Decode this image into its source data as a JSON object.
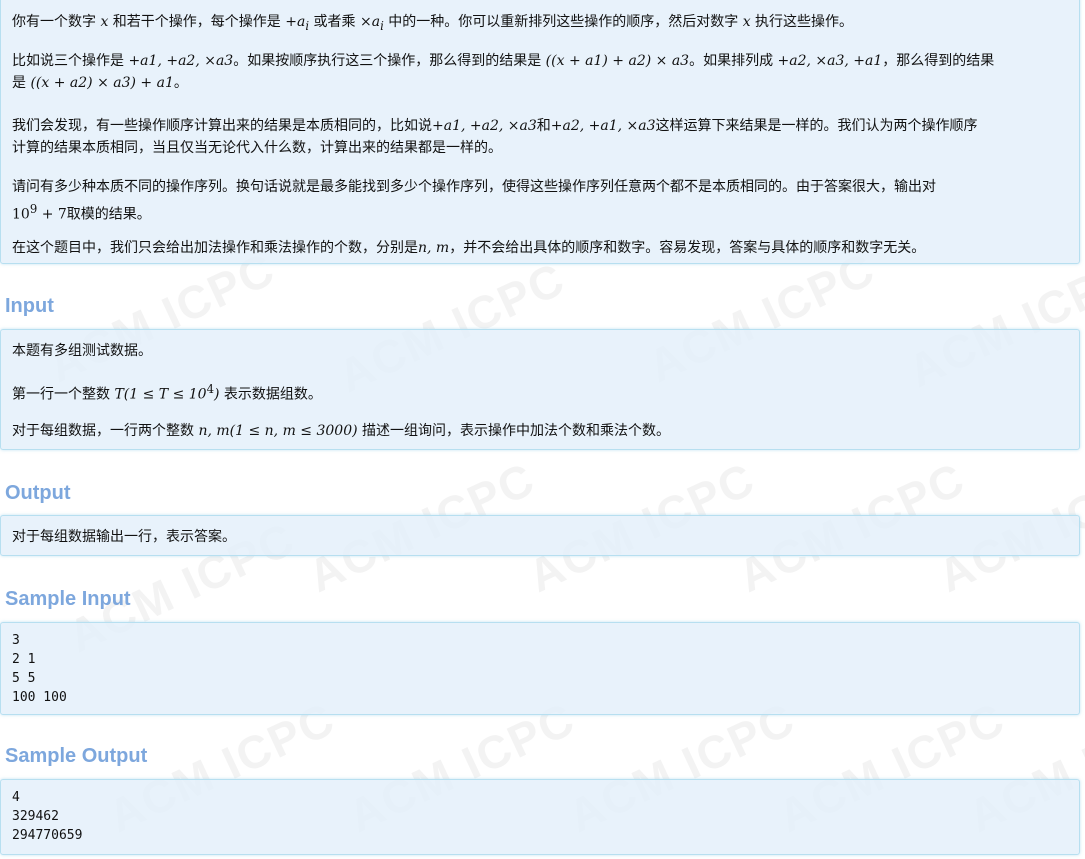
{
  "description": {
    "p1": {
      "t1": "你有一个数字 ",
      "x1": "x",
      "t2": " 和若干个操作，每个操作是 ",
      "op1": "+a",
      "t3": " 或者乘 ",
      "op2": "×a",
      "t4": " 中的一种。你可以重新排列这些操作的顺序，然后对数字 ",
      "x2": "x",
      "t5": " 执行这些操作。"
    },
    "p2": {
      "t1": "比如说三个操作是 ",
      "ops": "+a1, +a2, ×a3",
      "t2": "。如果按顺序执行这三个操作，那么得到的结果是 ",
      "expr1": "((x + a1) + a2) × a3",
      "t3": "。如果排列成 ",
      "ops2": "+a2, ×a3, +a1",
      "t4": "，那么得到的结果",
      "line2_t1": "是 ",
      "expr2": "((x + a2) × a3) + a1",
      "line2_t2": "。"
    },
    "p3": {
      "t1": "我们会发现，有一些操作顺序计算出来的结果是本质相同的，比如说",
      "ops1": "+a1, +a2, ×a3",
      "t2": "和",
      "ops2": "+a2, +a1, ×a3",
      "t3": "这样运算下来结果是一样的。我们认为两个操作顺序",
      "line2": "计算的结果本质相同，当且仅当无论代入什么数，计算出来的结果都是一样的。"
    },
    "p4": {
      "line1": "请问有多少种本质不同的操作序列。换句话说就是最多能找到多少个操作序列，使得这些操作序列任意两个都不是本质相同的。由于答案很大，输出对",
      "mod_base": "10",
      "mod_exp": "9",
      "mod_rest": " + 7",
      "t_end": "取模的结果。"
    },
    "p5": {
      "t1": "在这个题目中，我们只会给出加法操作和乘法操作的个数，分别是",
      "vars": "n, m",
      "t2": "，并不会给出具体的顺序和数字。容易发现，答案与具体的顺序和数字无关。"
    }
  },
  "input": {
    "heading": "Input",
    "p1": "本题有多组测试数据。",
    "p2": {
      "t1": "第一行一个整数 ",
      "math": "T(1 ≤ T ≤ 10",
      "exp": "4",
      "close": ")",
      "t2": " 表示数据组数。"
    },
    "p3": {
      "t1": "对于每组数据，一行两个整数 ",
      "math": "n, m(1 ≤ n, m ≤ 3000)",
      "t2": " 描述一组询问，表示操作中加法个数和乘法个数。"
    }
  },
  "output": {
    "heading": "Output",
    "p1": "对于每组数据输出一行，表示答案。"
  },
  "sample_input": {
    "heading": "Sample Input",
    "lines": [
      "3",
      "2 1",
      "5 5",
      "100 100"
    ]
  },
  "sample_output": {
    "heading": "Sample Output",
    "lines": [
      "4",
      "329462",
      "294770659"
    ]
  },
  "watermark": {
    "text": "ACM ICPC"
  }
}
